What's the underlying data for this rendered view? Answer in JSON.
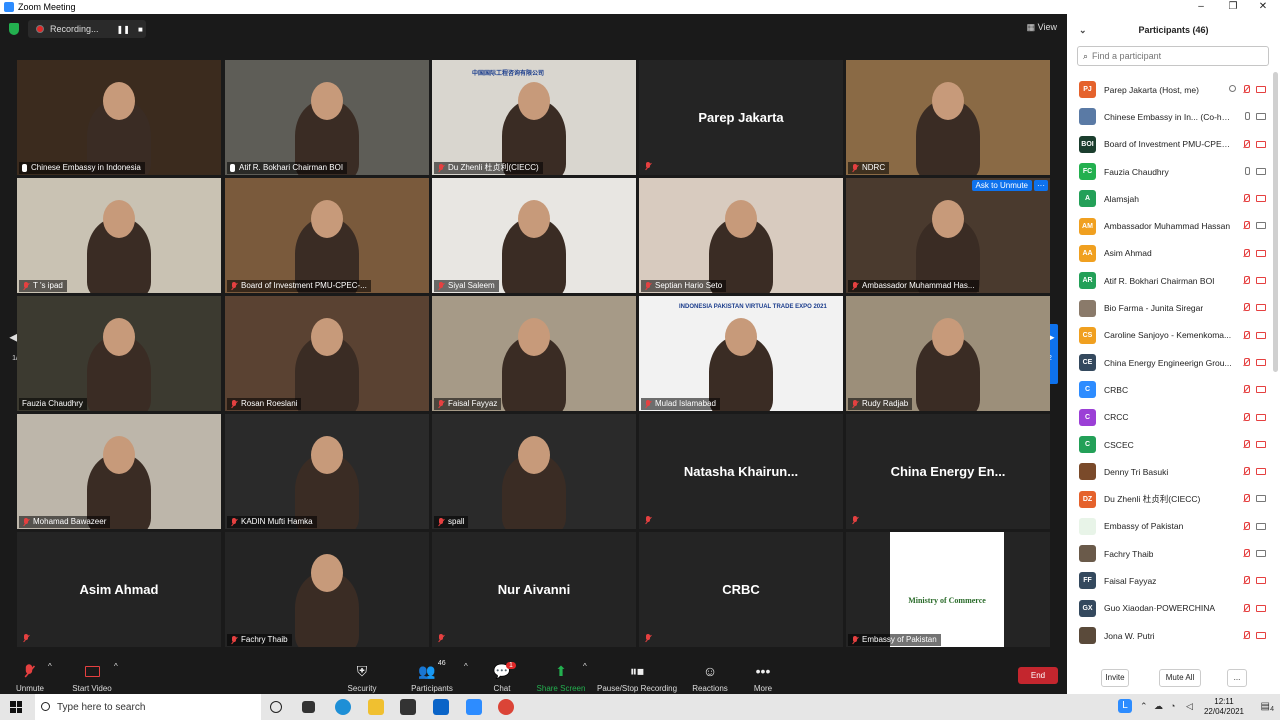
{
  "window": {
    "title": "Zoom Meeting",
    "minimize": "–",
    "maximize": "❐",
    "close": "✕"
  },
  "topbar": {
    "recording_label": "Recording...",
    "pause_glyph": "❚❚",
    "stop_glyph": "■",
    "view_label": "View"
  },
  "grid": {
    "page_left": "1/2",
    "page_right": "1/2",
    "ask_to_unmute": "Ask to Unmute",
    "more_glyph": "···",
    "tiles": [
      {
        "name": "Chinese Embassy in Indonesia",
        "mic": "on",
        "active": true,
        "bg": "#3b2b1e"
      },
      {
        "name": "Atif R. Bokhari Chairman BOI",
        "mic": "on",
        "bg": "#5e5d57"
      },
      {
        "name": "Du Zhenli 杜贞利(CIECC)",
        "mic": "off",
        "bg": "#d9d6cf",
        "banner": "中国国际工程咨询有限公司"
      },
      {
        "name": "Parep Jakarta",
        "mic": "off",
        "big": true
      },
      {
        "name": "NDRC",
        "mic": "off",
        "bg": "#8a6a45"
      },
      {
        "name": "T 's ipad",
        "mic": "off",
        "bg": "#c9c2b3"
      },
      {
        "name": "Board of Investment PMU-CPEC-...",
        "mic": "off",
        "bg": "#7a5a3c"
      },
      {
        "name": "Siyal Saleem",
        "mic": "off",
        "bg": "#e8e6e2"
      },
      {
        "name": "Septian Hario Seto",
        "mic": "off",
        "bg": "#d8cbbf"
      },
      {
        "name": "Ambassador Muhammad Has...",
        "mic": "off",
        "bg": "#4a3a2e"
      },
      {
        "name": "Fauzia Chaudhry",
        "mic": "none",
        "bg": "#3c3a30"
      },
      {
        "name": "Rosan Roeslani",
        "mic": "off",
        "bg": "#5a4232"
      },
      {
        "name": "Faisal Fayyaz",
        "mic": "off",
        "bg": "#a69a87"
      },
      {
        "name": "Mulad Islamabad",
        "mic": "off",
        "bg": "#f2f2f2",
        "banner": "INDONESIA PAKISTAN VIRTUAL TRADE EXPO 2021"
      },
      {
        "name": "Rudy Radjab",
        "mic": "off",
        "bg": "#9c8f7a"
      },
      {
        "name": "Mohamad Bawazeer",
        "mic": "off",
        "bg": "#bdb6aa"
      },
      {
        "name": "KADIN Mufti Hamka",
        "mic": "off",
        "bg": "#2a2a2a"
      },
      {
        "name": "spall",
        "mic": "off",
        "bg": "#2a2a2a"
      },
      {
        "name": "Natasha Khairun...",
        "mic": "off",
        "big": true
      },
      {
        "name": "China Energy En...",
        "mic": "off",
        "big": true
      },
      {
        "name": "Asim Ahmad",
        "mic": "off",
        "big": true
      },
      {
        "name": "Fachry Thaib",
        "mic": "off",
        "bg": "#242424"
      },
      {
        "name": "Nur Aivanni",
        "mic": "off",
        "big": true
      },
      {
        "name": "CRBC",
        "mic": "off",
        "big": true
      },
      {
        "name": "Embassy of Pakistan",
        "mic": "off",
        "bg": "#242424",
        "banner": "Ministry of Commerce"
      }
    ]
  },
  "toolbar": {
    "unmute": "Unmute",
    "start_video": "Start Video",
    "security": "Security",
    "participants": "Participants",
    "participants_count": "46",
    "chat": "Chat",
    "chat_badge": "1",
    "share_screen": "Share Screen",
    "recording": "Pause/Stop Recording",
    "reactions": "Reactions",
    "more": "More",
    "end": "End",
    "caret": "^"
  },
  "panel": {
    "title": "Participants (46)",
    "collapse_glyph": "⌄",
    "search_placeholder": "Find a participant",
    "participants": [
      {
        "initials": "PJ",
        "name": "Parep Jakarta (Host, me)",
        "color": "#e5622c",
        "icons": [
          "share",
          "mute",
          "cam"
        ]
      },
      {
        "initials": "",
        "name": "Chinese Embassy in In... (Co-host)",
        "color": "#5a7aa5",
        "icons": [
          "mic",
          "cam-on"
        ]
      },
      {
        "initials": "BOI",
        "name": "Board of Investment PMU-CPEC...",
        "color": "#1b3e2e",
        "icons": [
          "mute",
          "cam"
        ]
      },
      {
        "initials": "FC",
        "name": "Fauzia Chaudhry",
        "color": "#23b04f",
        "icons": [
          "mic",
          "cam-on"
        ]
      },
      {
        "initials": "A",
        "name": "Alamsjah",
        "color": "#23a058",
        "icons": [
          "mute",
          "cam"
        ]
      },
      {
        "initials": "AM",
        "name": "Ambassador Muhammad Hassan",
        "color": "#f0a020",
        "icons": [
          "mute",
          "cam-on"
        ]
      },
      {
        "initials": "AA",
        "name": "Asim Ahmad",
        "color": "#f0a020",
        "icons": [
          "mute",
          "cam"
        ]
      },
      {
        "initials": "AR",
        "name": "Atif R. Bokhari Chairman BOI",
        "color": "#23a058",
        "icons": [
          "mute",
          "cam"
        ]
      },
      {
        "initials": "",
        "name": "Bio Farma - Junita Siregar",
        "color": "#8a7a6a",
        "icons": [
          "mute",
          "cam"
        ]
      },
      {
        "initials": "CS",
        "name": "Caroline Sanjoyo - Kemenkoma...",
        "color": "#f0a020",
        "icons": [
          "mute",
          "cam"
        ]
      },
      {
        "initials": "CE",
        "name": "China Energy Engineerign Grou...",
        "color": "#34495e",
        "icons": [
          "mute",
          "cam"
        ]
      },
      {
        "initials": "C",
        "name": "CRBC",
        "color": "#2d8cff",
        "icons": [
          "mute",
          "cam"
        ]
      },
      {
        "initials": "C",
        "name": "CRCC",
        "color": "#9b3fd6",
        "icons": [
          "mute",
          "cam"
        ]
      },
      {
        "initials": "C",
        "name": "CSCEC",
        "color": "#23a058",
        "icons": [
          "mute",
          "cam"
        ]
      },
      {
        "initials": "",
        "name": "Denny Tri Basuki",
        "color": "#7a4a2a",
        "icons": [
          "mute",
          "cam"
        ]
      },
      {
        "initials": "DZ",
        "name": "Du Zhenli 杜贞利(CIECC)",
        "color": "#e5622c",
        "icons": [
          "mute",
          "cam-on"
        ]
      },
      {
        "initials": "",
        "name": "Embassy of Pakistan",
        "color": "#e8f4e8",
        "icons": [
          "mute",
          "cam-on"
        ]
      },
      {
        "initials": "",
        "name": "Fachry Thaib",
        "color": "#6a5a4a",
        "icons": [
          "mute",
          "cam-on"
        ]
      },
      {
        "initials": "FF",
        "name": "Faisal Fayyaz",
        "color": "#34495e",
        "icons": [
          "mute",
          "cam"
        ]
      },
      {
        "initials": "GX",
        "name": "Guo Xiaodan·POWERCHINA",
        "color": "#34495e",
        "icons": [
          "mute",
          "cam"
        ]
      },
      {
        "initials": "",
        "name": "Jona W. Putri",
        "color": "#5a4a3a",
        "icons": [
          "mute",
          "cam"
        ]
      }
    ],
    "invite": "Invite",
    "mute_all": "Mute All",
    "more": "..."
  },
  "taskbar": {
    "search_placeholder": "Type here to search",
    "time": "12:11",
    "date": "22/04/2021",
    "lang": "L",
    "notif": "4"
  }
}
